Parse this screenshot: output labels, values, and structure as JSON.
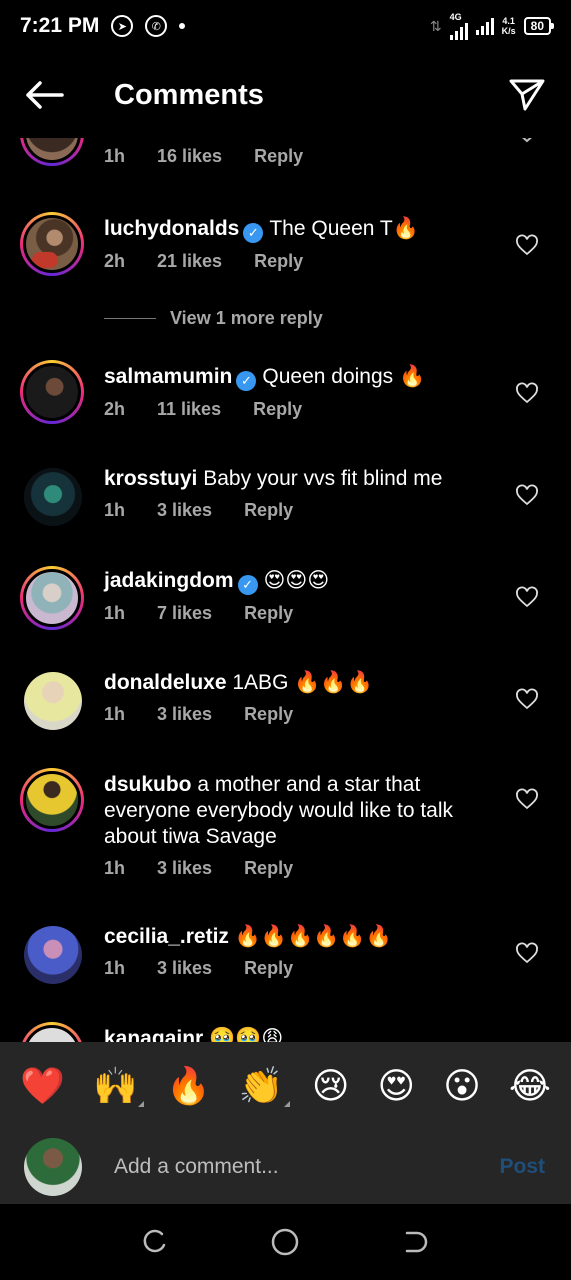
{
  "status_bar": {
    "time": "7:21 PM",
    "network": "4G",
    "speed_value": "4.1",
    "speed_unit": "K/s",
    "battery": "80"
  },
  "header": {
    "title": "Comments"
  },
  "view_more_label": "View 1 more reply",
  "comments": [
    {
      "username": "",
      "text": "",
      "time": "1h",
      "likes": "16 likes",
      "reply": "Reply"
    },
    {
      "username": "luchydonalds",
      "text": "The Queen T🔥",
      "time": "2h",
      "likes": "21 likes",
      "reply": "Reply"
    },
    {
      "username": "salmamumin",
      "text": "Queen doings 🔥",
      "time": "2h",
      "likes": "11 likes",
      "reply": "Reply"
    },
    {
      "username": "krosstuyi",
      "text": "Baby your vvs fit blind me",
      "time": "1h",
      "likes": "3 likes",
      "reply": "Reply"
    },
    {
      "username": "jadakingdom",
      "text": "😍😍😍",
      "time": "1h",
      "likes": "7 likes",
      "reply": "Reply"
    },
    {
      "username": "donaldeluxe",
      "text": "1ABG 🔥🔥🔥",
      "time": "1h",
      "likes": "3 likes",
      "reply": "Reply"
    },
    {
      "username": "dsukubo",
      "text": "a mother and a star that everyone everybody would like to talk about tiwa Savage",
      "time": "1h",
      "likes": "3 likes",
      "reply": "Reply"
    },
    {
      "username": "cecilia_.retiz",
      "text": "🔥🔥🔥🔥🔥🔥",
      "time": "1h",
      "likes": "3 likes",
      "reply": "Reply"
    },
    {
      "username": "kanagainr",
      "text": "🥹🥹😩"
    }
  ],
  "emoji_bar": [
    "❤️",
    "🙌",
    "🔥",
    "👏",
    "😢",
    "😍",
    "😮",
    "😂"
  ],
  "add_comment": {
    "placeholder": "Add a comment...",
    "post_label": "Post"
  },
  "colors": {
    "background": "#000000",
    "panel": "#262626",
    "muted_text": "#a8a8a8",
    "verified": "#3897f0",
    "post_disabled": "#1f4e79"
  }
}
